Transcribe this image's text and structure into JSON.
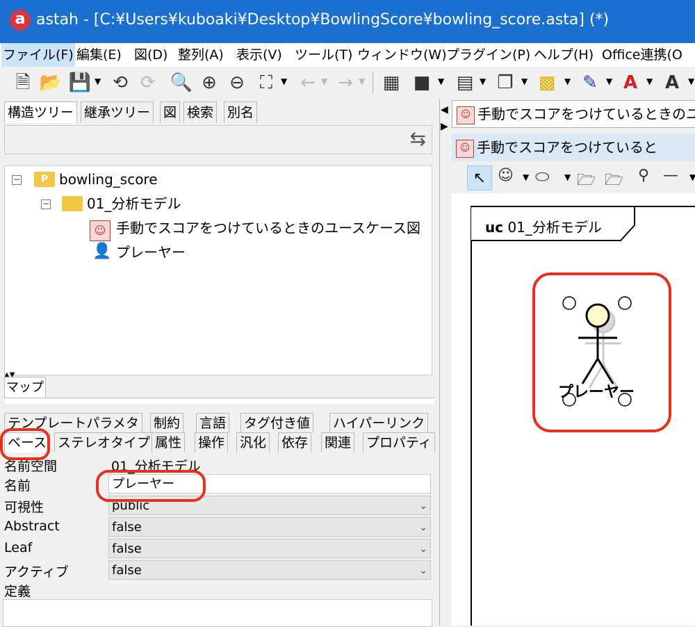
{
  "window": {
    "title": "astah - [C:¥Users¥kuboaki¥Desktop¥BowlingScore¥bowling_score.asta] (*)",
    "logo": "a"
  },
  "menu": [
    "ファイル(F)",
    "編集(E)",
    "図(D)",
    "整列(A)",
    "表示(V)",
    "ツール(T)",
    "ウィンドウ(W)",
    "プラグイン(P)",
    "ヘルプ(H)",
    "Office連携(O"
  ],
  "explorer": {
    "tabs": [
      "構造ツリー",
      "継承ツリー",
      "図",
      "検索",
      "別名"
    ],
    "tree": {
      "root": "bowling_score",
      "root_icon": "P",
      "package": "01_分析モデル",
      "diagram": "手動でスコアをつけているときのユースケース図",
      "actor": "プレーヤー"
    },
    "map_tab": "マップ"
  },
  "properties": {
    "tabs_row1": [
      "テンプレートパラメタ",
      "制約",
      "言語",
      "タグ付き値",
      "ハイパーリンク"
    ],
    "tabs_row2": [
      "ベース",
      "ステレオタイプ",
      "属性",
      "操作",
      "汎化",
      "依存",
      "関連",
      "プロパティ"
    ],
    "namespace_label": "名前空間",
    "namespace_value": "01_分析モデル",
    "name_label": "名前",
    "name_value": "プレーヤー",
    "visibility_label": "可視性",
    "visibility_value": "public",
    "abstract_label": "Abstract",
    "abstract_value": "false",
    "leaf_label": "Leaf",
    "leaf_value": "false",
    "active_label": "アクティブ",
    "active_value": "false",
    "definition_label": "定義"
  },
  "diagram": {
    "tab_title": "手動でスコアをつけているときのユ",
    "inner_title": "手動でスコアをつけていると",
    "frame_keyword": "uc",
    "frame_name": "01_分析モデル",
    "actor_label": "プレーヤー"
  },
  "colors": {
    "titlebar": "#1a6fd1",
    "highlight": "#e8301e",
    "selection": "#cce4f7",
    "folder": "#f2c744"
  }
}
